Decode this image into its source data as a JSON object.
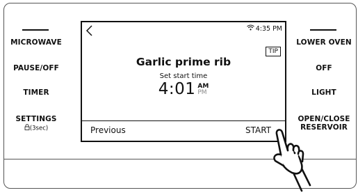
{
  "left_controls": [
    {
      "label": "MICROWAVE"
    },
    {
      "label": "PAUSE/OFF"
    },
    {
      "label": "TIMER"
    },
    {
      "label": "SETTINGS",
      "sublabel": "(3sec)"
    }
  ],
  "right_controls": [
    {
      "label": "LOWER OVEN"
    },
    {
      "label": "OFF"
    },
    {
      "label": "LIGHT"
    },
    {
      "label": "OPEN/CLOSE",
      "label2": "RESERVOIR"
    }
  ],
  "screen": {
    "status_time": "4:35 PM",
    "tip_label": "TIP",
    "title": "Garlic prime rib",
    "subtitle": "Set start time",
    "time": "4:01",
    "am": "AM",
    "pm": "PM",
    "previous_label": "Previous",
    "start_label": "START"
  },
  "icons": {
    "back": "chevron-left-icon",
    "wifi": "wifi-icon",
    "lock": "lock-icon",
    "hand": "pointing-hand-icon"
  }
}
